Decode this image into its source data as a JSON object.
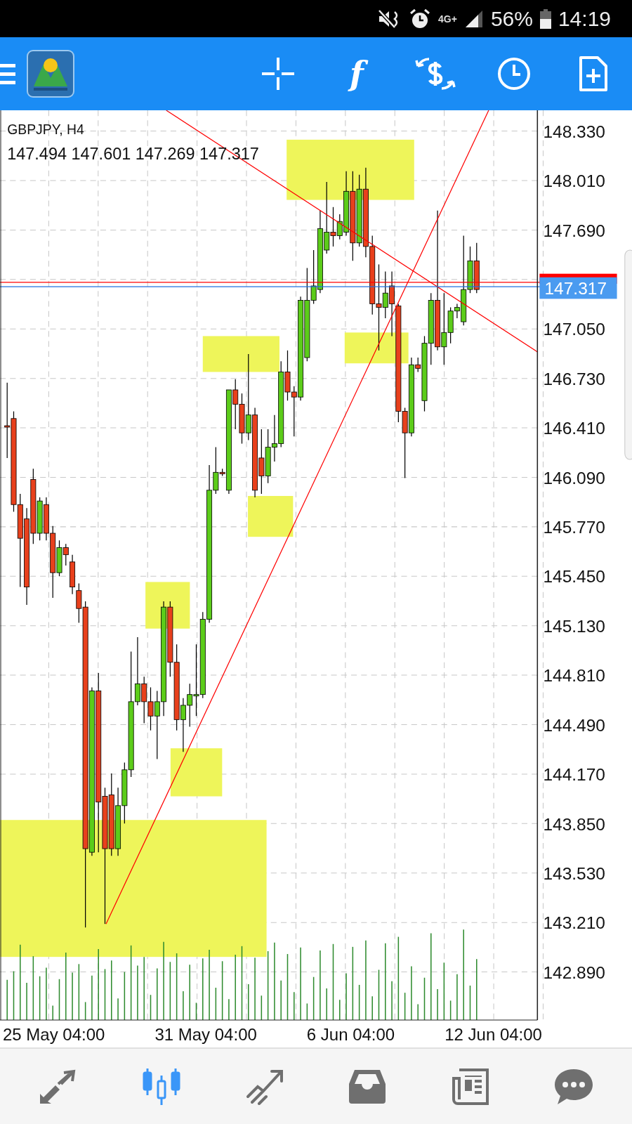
{
  "status_bar": {
    "network": "4G+",
    "battery": "56%",
    "time": "14:19"
  },
  "toolbar": {
    "function_glyph": "f"
  },
  "chart": {
    "symbol": "GBPJPY, H4",
    "ohlc": "147.494 147.601 147.269 147.317",
    "price_ticks": [
      "148.330",
      "148.010",
      "147.690",
      "147.050",
      "146.730",
      "146.410",
      "146.090",
      "145.770",
      "145.450",
      "145.130",
      "144.810",
      "144.490",
      "144.170",
      "143.850",
      "143.530",
      "143.210",
      "142.890"
    ],
    "current_price": "147.317",
    "time_labels": [
      "25 May 04:00",
      "31 May 04:00",
      "6 Jun 04:00",
      "12 Jun 04:00"
    ]
  },
  "bottom_nav": [
    {
      "kind": "trade",
      "selected": false
    },
    {
      "kind": "candles",
      "selected": true
    },
    {
      "kind": "trend",
      "selected": false
    },
    {
      "kind": "inbox",
      "selected": false
    },
    {
      "kind": "news",
      "selected": false
    },
    {
      "kind": "chat",
      "selected": false
    }
  ]
}
